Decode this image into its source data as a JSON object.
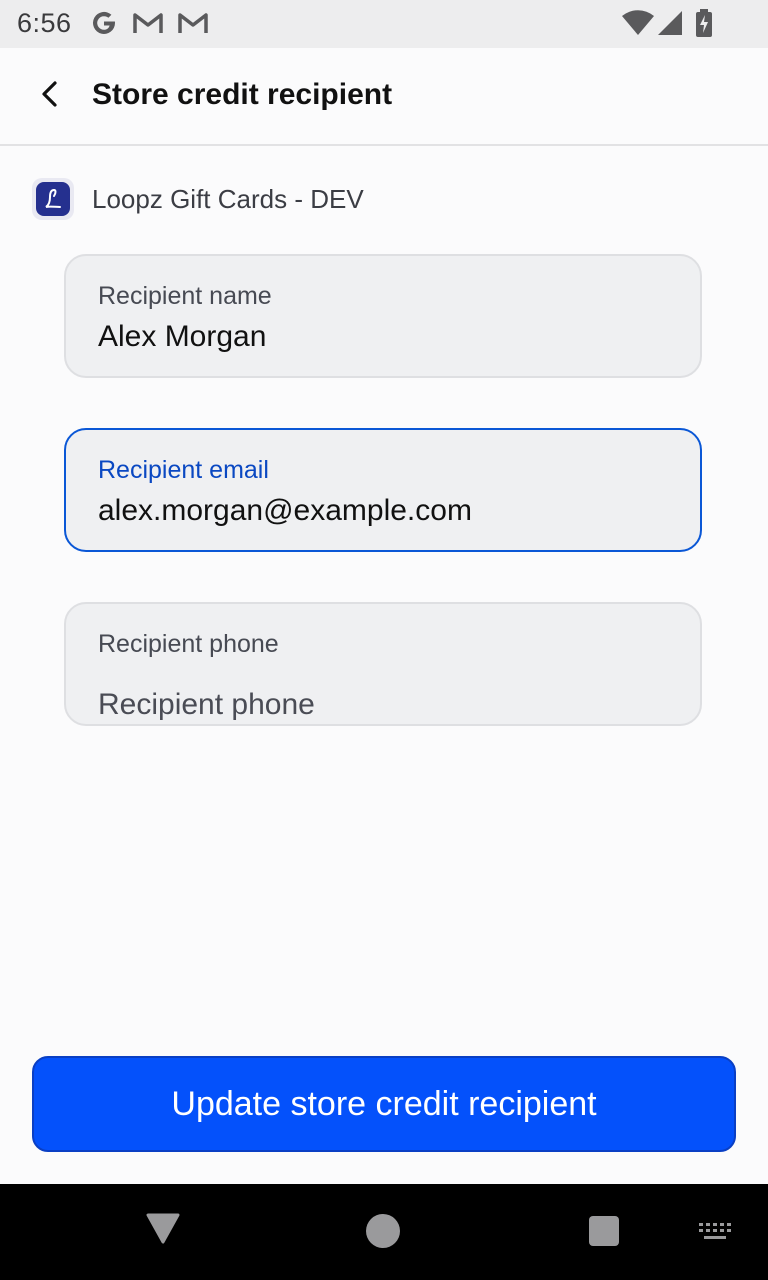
{
  "status_bar": {
    "time": "6:56",
    "icons": [
      "google-icon",
      "gmail-icon",
      "gmail-icon",
      "wifi-icon",
      "signal-icon",
      "battery-charging-icon"
    ]
  },
  "header": {
    "title": "Store credit recipient",
    "back_icon": "arrow-back-icon"
  },
  "merchant": {
    "name": "Loopz Gift Cards - DEV",
    "logo_icon": "merchant-logo-icon"
  },
  "form": {
    "name": {
      "label": "Recipient name",
      "value": "Alex Morgan"
    },
    "email": {
      "label": "Recipient email",
      "value": "alex.morgan@example.com"
    },
    "phone": {
      "label": "Recipient phone",
      "placeholder": "Recipient phone",
      "value": ""
    }
  },
  "actions": {
    "update_label": "Update store credit recipient"
  },
  "colors": {
    "primary": "#0451fb",
    "focus": "#0a57d6",
    "field_bg": "#eff0f2"
  }
}
